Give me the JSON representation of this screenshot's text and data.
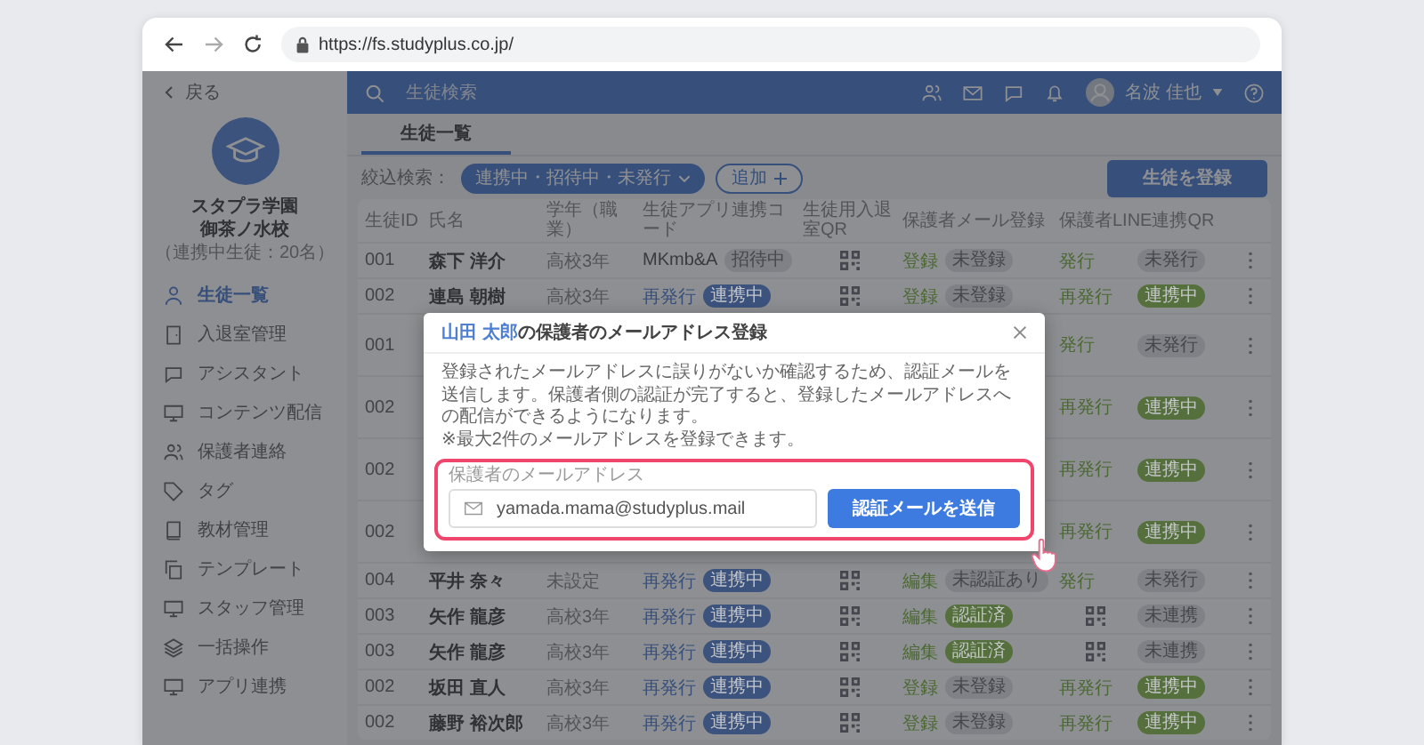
{
  "browser": {
    "url": "https://fs.studyplus.co.jp/"
  },
  "sidebar": {
    "back": "戻る",
    "school_name": "スタプラ学園",
    "campus": "御茶ノ水校",
    "member_count": "（連携中生徒：20名）",
    "items": [
      {
        "label": "生徒一覧",
        "selected": true
      },
      {
        "label": "入退室管理",
        "selected": false
      },
      {
        "label": "アシスタント",
        "selected": false
      },
      {
        "label": "コンテンツ配信",
        "selected": false
      },
      {
        "label": "保護者連絡",
        "selected": false
      },
      {
        "label": "タグ",
        "selected": false
      },
      {
        "label": "教材管理",
        "selected": false
      },
      {
        "label": "テンプレート",
        "selected": false
      },
      {
        "label": "スタッフ管理",
        "selected": false
      },
      {
        "label": "一括操作",
        "selected": false
      },
      {
        "label": "アプリ連携",
        "selected": false
      }
    ]
  },
  "topbar": {
    "search_placeholder": "生徒検索",
    "user_name": "名波 佳也"
  },
  "tabs": [
    {
      "label": "生徒一覧",
      "selected": true
    }
  ],
  "filter": {
    "label": "絞込検索：",
    "chip": "連携中・招待中・未発行",
    "add": "追加"
  },
  "register_button": "生徒を登録",
  "table": {
    "columns": [
      "生徒ID",
      "氏名",
      "学年（職業）",
      "生徒アプリ連携コード",
      "生徒用入退室QR",
      "保護者メール登録",
      "保護者LINE連携QR"
    ],
    "rows": [
      {
        "id": "001",
        "name": "森下 洋介",
        "grade": "高校3年",
        "code": {
          "kind": "text",
          "text": "MKmb&A"
        },
        "code_badge": {
          "text": "招待中",
          "color": "#7f8186"
        },
        "student_qr": true,
        "mail": "登録",
        "mail_badge": {
          "text": "未登録",
          "color": "#7f8186"
        },
        "line": {
          "kind": "link",
          "text": "発行"
        },
        "line_badge": {
          "text": "未発行",
          "color": "#7f8186"
        }
      },
      {
        "id": "002",
        "name": "連島 朝樹",
        "grade": "高校3年",
        "code": {
          "kind": "link",
          "text": "再発行"
        },
        "code_badge": {
          "text": "連携中",
          "color": "#3c537e"
        },
        "student_qr": true,
        "mail": "登録",
        "mail_badge": {
          "text": "未登録",
          "color": "#7f8186"
        },
        "line": {
          "kind": "link",
          "text": "再発行"
        },
        "line_badge": {
          "text": "連携中",
          "color": "#55703c"
        }
      },
      {
        "id": "001",
        "line": {
          "kind": "link",
          "text": "発行"
        },
        "line_badge": {
          "text": "未発行",
          "color": "#7f8186"
        }
      },
      {
        "id": "002",
        "line": {
          "kind": "link",
          "text": "再発行"
        },
        "line_badge": {
          "text": "連携中",
          "color": "#55703c"
        }
      },
      {
        "id": "002",
        "line": {
          "kind": "link",
          "text": "再発行"
        },
        "line_badge": {
          "text": "連携中",
          "color": "#55703c"
        }
      },
      {
        "id": "002",
        "line": {
          "kind": "link",
          "text": "再発行"
        },
        "line_badge": {
          "text": "連携中",
          "color": "#55703c"
        }
      },
      {
        "id": "004",
        "name": "平井 奈々",
        "grade": "未設定",
        "code": {
          "kind": "link",
          "text": "再発行"
        },
        "code_badge": {
          "text": "連携中",
          "color": "#3c537e"
        },
        "student_qr": true,
        "mail": "編集",
        "mail_badge": {
          "text": "未認証あり",
          "color": "#7f8186"
        },
        "line": {
          "kind": "link",
          "text": "発行"
        },
        "line_badge": {
          "text": "未発行",
          "color": "#7f8186"
        }
      },
      {
        "id": "003",
        "name": "矢作 龍彦",
        "grade": "高校3年",
        "code": {
          "kind": "link",
          "text": "再発行"
        },
        "code_badge": {
          "text": "連携中",
          "color": "#3c537e"
        },
        "student_qr": true,
        "mail": "編集",
        "mail_badge": {
          "text": "認証済",
          "color": "#55703c"
        },
        "line": {
          "kind": "qr"
        },
        "line_badge": {
          "text": "未連携",
          "color": "#7f8186"
        }
      },
      {
        "id": "003",
        "name": "矢作 龍彦",
        "grade": "高校3年",
        "code": {
          "kind": "link",
          "text": "再発行"
        },
        "code_badge": {
          "text": "連携中",
          "color": "#3c537e"
        },
        "student_qr": true,
        "mail": "編集",
        "mail_badge": {
          "text": "認証済",
          "color": "#55703c"
        },
        "line": {
          "kind": "qr"
        },
        "line_badge": {
          "text": "未連携",
          "color": "#7f8186"
        }
      },
      {
        "id": "002",
        "name": "坂田 直人",
        "grade": "高校3年",
        "code": {
          "kind": "link",
          "text": "再発行"
        },
        "code_badge": {
          "text": "連携中",
          "color": "#3c537e"
        },
        "student_qr": true,
        "mail": "登録",
        "mail_badge": {
          "text": "未登録",
          "color": "#7f8186"
        },
        "line": {
          "kind": "link",
          "text": "再発行"
        },
        "line_badge": {
          "text": "連携中",
          "color": "#55703c"
        }
      },
      {
        "id": "002",
        "name": "藤野 裕次郎",
        "grade": "高校3年",
        "code": {
          "kind": "link",
          "text": "再発行"
        },
        "code_badge": {
          "text": "連携中",
          "color": "#3c537e"
        },
        "student_qr": true,
        "mail": "登録",
        "mail_badge": {
          "text": "未登録",
          "color": "#7f8186"
        },
        "line": {
          "kind": "link",
          "text": "再発行"
        },
        "line_badge": {
          "text": "連携中",
          "color": "#55703c"
        }
      }
    ]
  },
  "modal": {
    "title_name": "山田 太郎",
    "title_rest": "の保護者のメールアドレス登録",
    "description": "登録されたメールアドレスに誤りがないか確認するため、認証メールを送信します。保護者側の認証が完了すると、登録したメールアドレスへの配信ができるようになります。",
    "note": "※最大2件のメールアドレスを登録できます。",
    "field_label": "保護者のメールアドレス",
    "email": "yamada.mama@studyplus.mail",
    "send_button": "認証メールを送信"
  }
}
